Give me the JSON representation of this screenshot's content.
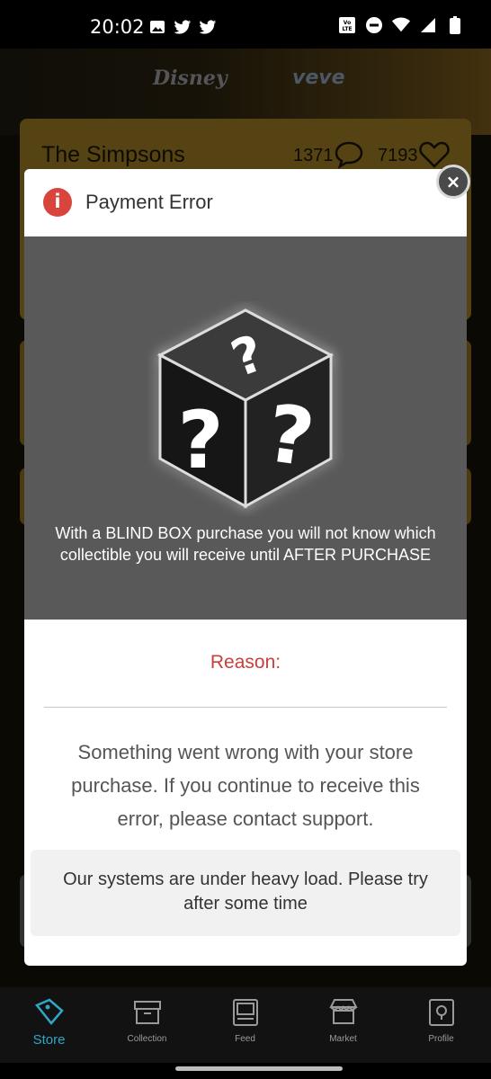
{
  "status_bar": {
    "time": "20:02",
    "icons_left": [
      "gallery-icon",
      "twitter-icon",
      "twitter-icon"
    ],
    "icons_right": [
      "volte-icon",
      "do-not-disturb-icon",
      "wifi-icon",
      "signal-icon",
      "battery-icon"
    ]
  },
  "background": {
    "brand_left": "Disney",
    "brand_right": "veve",
    "card_title": "The Simpsons",
    "comments_count": "1371",
    "likes_count": "7193"
  },
  "modal": {
    "title": "Payment Error",
    "caption": "With a BLIND BOX purchase you will not know which collectible you will receive until AFTER PURCHASE",
    "reason_label": "Reason:",
    "message": "Something went wrong with your store purchase. If you continue to receive this error, please contact support.",
    "notice": "Our systems are under heavy load. Please try after some time",
    "close_symbol": "×",
    "error_symbol": "i"
  },
  "bottom_nav": {
    "items": [
      {
        "label": "Store",
        "active": true
      },
      {
        "label": "Collection",
        "active": false
      },
      {
        "label": "Feed",
        "active": false
      },
      {
        "label": "Market",
        "active": false
      },
      {
        "label": "Profile",
        "active": false
      }
    ]
  },
  "colors": {
    "error_red": "#d9443c",
    "accent_blue": "#2fa7c7",
    "card_gold": "#9c7a24",
    "image_gray": "#595959"
  }
}
